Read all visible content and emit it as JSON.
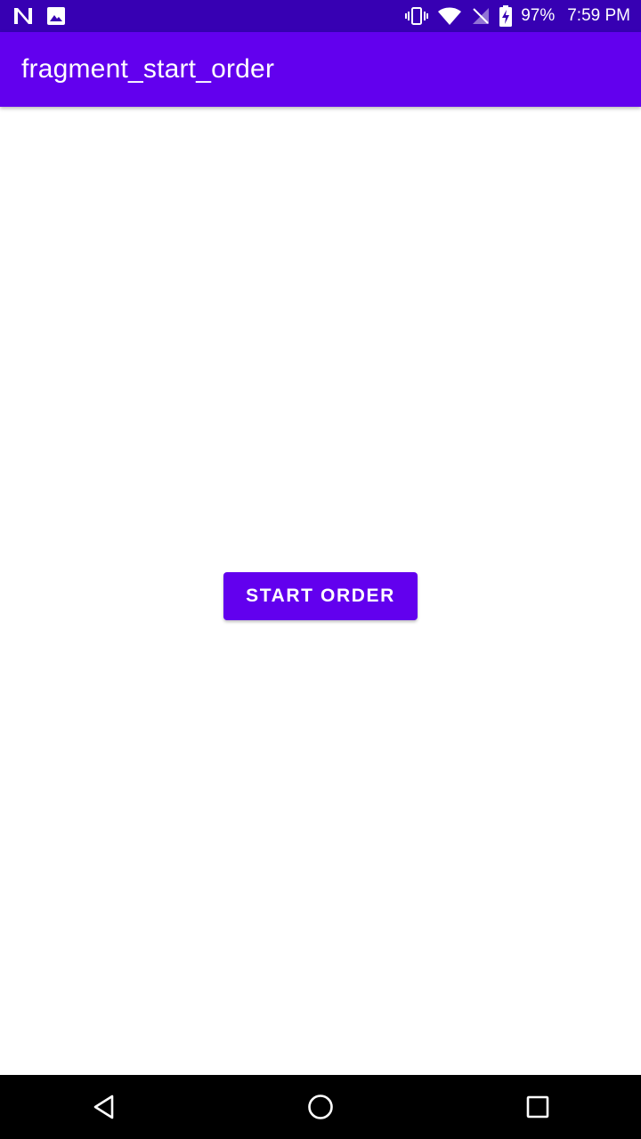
{
  "status_bar": {
    "battery_percent": "97%",
    "time": "7:59 PM",
    "left_icons": [
      "notification-n-icon",
      "image-icon"
    ],
    "right_icons": [
      "vibrate-icon",
      "wifi-icon",
      "no-sim-icon",
      "battery-charging-icon"
    ]
  },
  "app_bar": {
    "title": "fragment_start_order"
  },
  "main": {
    "start_button_label": "START ORDER"
  },
  "nav_bar": {
    "icons": [
      "back-icon",
      "home-icon",
      "recents-icon"
    ]
  },
  "colors": {
    "status_bar": "#3700b3",
    "app_bar": "#6200ee",
    "button": "#6200ee",
    "background": "#ffffff",
    "nav_bar": "#000000"
  }
}
